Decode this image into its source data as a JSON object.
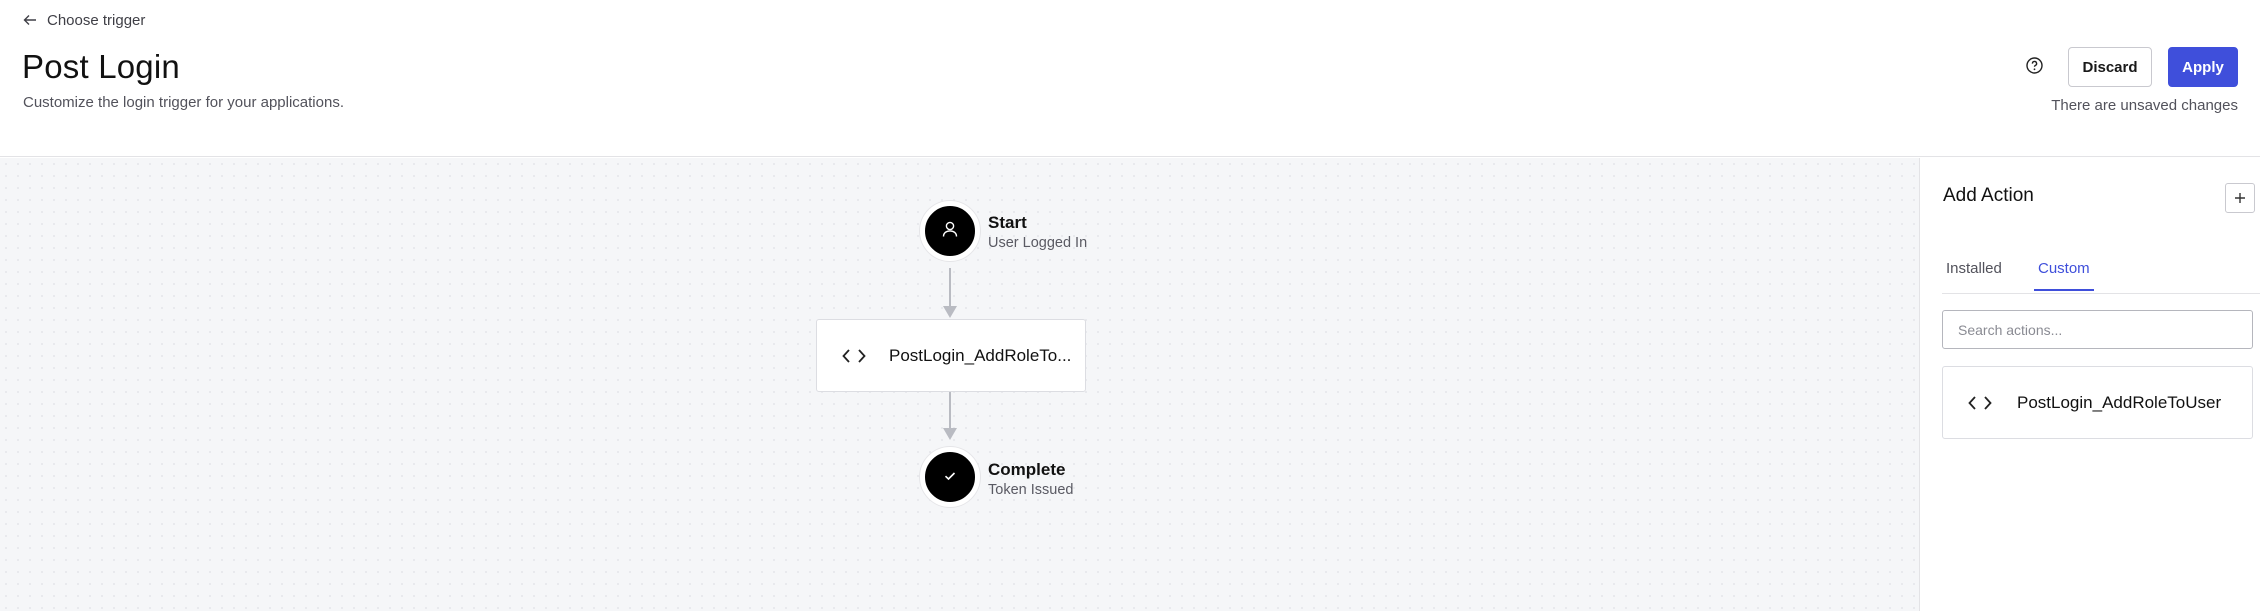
{
  "header": {
    "back_label": "Choose trigger",
    "title": "Post Login",
    "subtitle": "Customize the login trigger for your applications.",
    "discard_label": "Discard",
    "apply_label": "Apply",
    "unsaved_text": "There are unsaved changes"
  },
  "flow": {
    "start": {
      "title": "Start",
      "subtitle": "User Logged In"
    },
    "action": {
      "label": "PostLogin_AddRoleTo..."
    },
    "complete": {
      "title": "Complete",
      "subtitle": "Token Issued"
    }
  },
  "panel": {
    "title": "Add Action",
    "tabs": [
      {
        "label": "Installed"
      },
      {
        "label": "Custom"
      }
    ],
    "active_tab": "Custom",
    "search_placeholder": "Search actions...",
    "actions": [
      {
        "label": "PostLogin_AddRoleToUser"
      }
    ]
  },
  "colors": {
    "accent": "#3f4fdb",
    "node": "#000000",
    "canvas": "#f5f6f8"
  }
}
